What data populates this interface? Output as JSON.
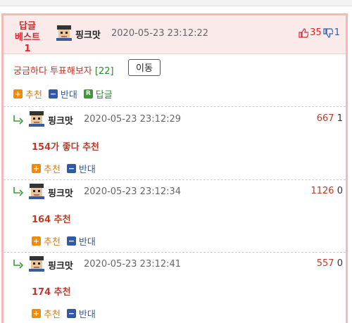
{
  "best_post": {
    "badge_line1": "답글",
    "badge_line2": "베스트1",
    "author": "핑크맛",
    "timestamp": "2020-05-23 23:12:22",
    "upvotes": "35",
    "downvotes": "1",
    "title": "궁금하다 투표해보자",
    "reply_count": "[22]",
    "move_label": "이동",
    "actions": {
      "recommend": "추천",
      "oppose": "반대",
      "reply": "답글"
    },
    "icons": {
      "recommend": "+",
      "oppose": "−",
      "reply": "R"
    }
  },
  "replies": [
    {
      "author": "핑크맛",
      "timestamp": "2020-05-23 23:12:29",
      "upvotes": "667",
      "downvotes": "1",
      "text": "154가 좋다 추천",
      "recommend": "추천",
      "oppose": "반대"
    },
    {
      "author": "핑크맛",
      "timestamp": "2020-05-23 23:12:34",
      "upvotes": "1126",
      "downvotes": "0",
      "text": "164 추천",
      "recommend": "추천",
      "oppose": "반대"
    },
    {
      "author": "핑크맛",
      "timestamp": "2020-05-23 23:12:41",
      "upvotes": "557",
      "downvotes": "0",
      "text": "174 추천",
      "recommend": "추천",
      "oppose": "반대"
    }
  ],
  "colors": {
    "accent_red": "#d9262b",
    "recommend_orange": "#f08a0b",
    "oppose_blue": "#2f5aa8",
    "reply_green": "#3a9a3a",
    "panel_border": "#f4b8b8",
    "header_bg": "#fbeaea"
  }
}
